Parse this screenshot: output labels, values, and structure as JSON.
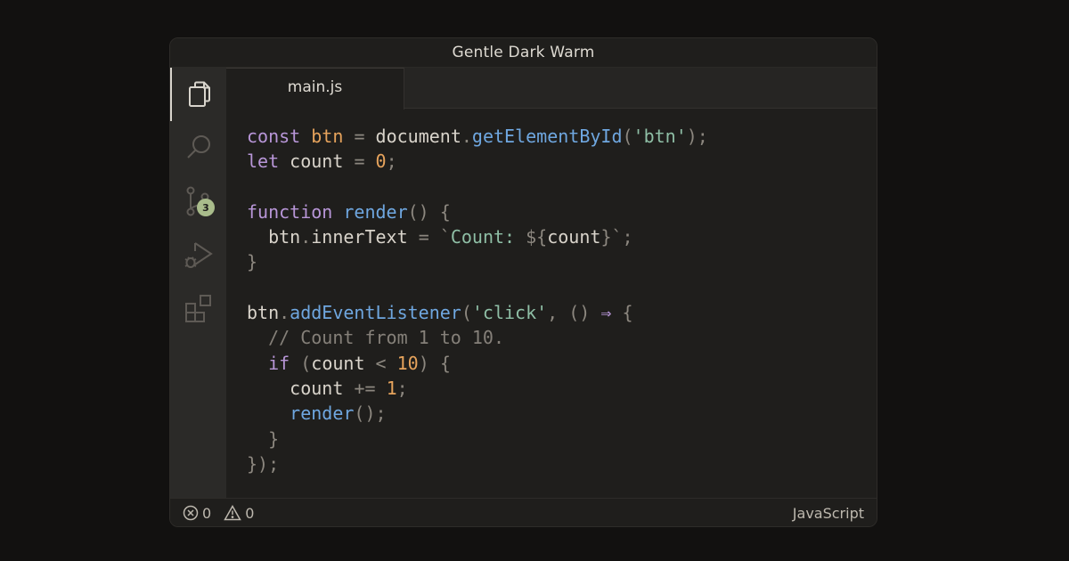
{
  "window": {
    "title": "Gentle Dark Warm"
  },
  "activity_bar": {
    "items": [
      {
        "icon": "files-icon",
        "active": true
      },
      {
        "icon": "search-icon"
      },
      {
        "icon": "source-control-icon",
        "badge": "3"
      },
      {
        "icon": "run-debug-icon"
      },
      {
        "icon": "extensions-icon"
      }
    ]
  },
  "editor": {
    "tab": {
      "label": "main.js"
    },
    "code_lines": [
      "const btn = document.getElementById('btn');",
      "let count = 0;",
      "",
      "function render() {",
      "  btn.innerText = `Count: ${count}`;",
      "}",
      "",
      "btn.addEventListener('click', () ⇒ {",
      "  // Count from 1 to 10.",
      "  if (count < 10) {",
      "    count += 1;",
      "    render();",
      "  }",
      "});"
    ]
  },
  "statusbar": {
    "errors": "0",
    "warnings": "0",
    "language": "JavaScript"
  },
  "colors": {
    "background": "#121110",
    "panel": "#1f1e1c",
    "activity_bar": "#2b2a28",
    "keyword": "#b896d8",
    "variable": "#e6a35c",
    "function": "#6fa7e0",
    "string": "#8fbfa6",
    "comment": "#858079",
    "badge": "#a9bc8b"
  }
}
